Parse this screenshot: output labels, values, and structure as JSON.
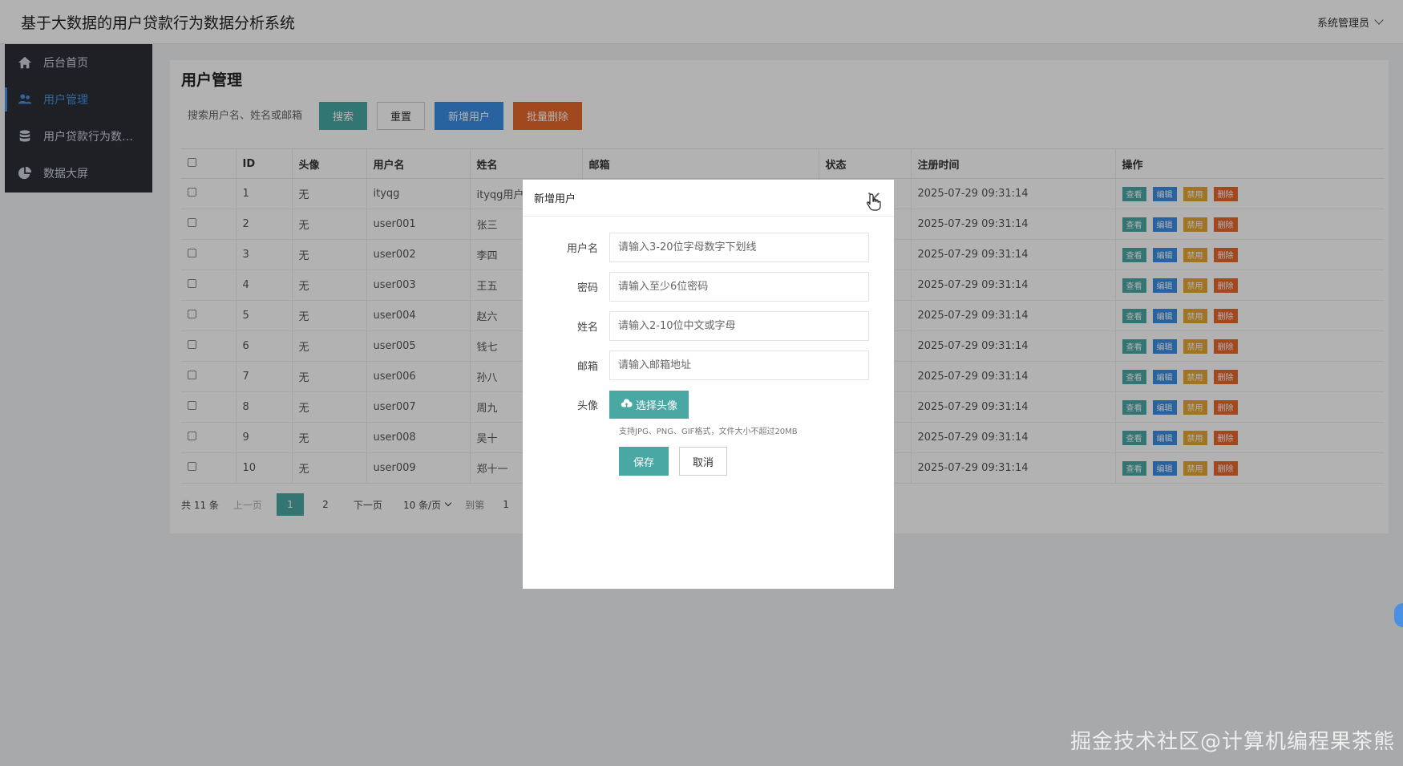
{
  "header": {
    "title": "基于大数据的用户贷款行为数据分析系统",
    "user": "系统管理员"
  },
  "sidebar": {
    "items": [
      {
        "label": "后台首页",
        "icon": "home-icon"
      },
      {
        "label": "用户管理",
        "icon": "users-icon"
      },
      {
        "label": "用户贷款行为数…",
        "icon": "database-icon"
      },
      {
        "label": "数据大屏",
        "icon": "pie-chart-icon"
      }
    ]
  },
  "main": {
    "title": "用户管理",
    "search_placeholder": "搜索用户名、姓名或邮箱",
    "buttons": {
      "search": "搜索",
      "reset": "重置",
      "add": "新增用户",
      "batch_delete": "批量删除"
    },
    "columns": [
      "ID",
      "头像",
      "用户名",
      "姓名",
      "邮箱",
      "状态",
      "注册时间",
      "操作"
    ],
    "rows": [
      {
        "id": "1",
        "avatar": "无",
        "username": "ityqg",
        "name": "ityqg用户",
        "time": "2025-07-29 09:31:14"
      },
      {
        "id": "2",
        "avatar": "无",
        "username": "user001",
        "name": "张三",
        "time": "2025-07-29 09:31:14"
      },
      {
        "id": "3",
        "avatar": "无",
        "username": "user002",
        "name": "李四",
        "time": "2025-07-29 09:31:14"
      },
      {
        "id": "4",
        "avatar": "无",
        "username": "user003",
        "name": "王五",
        "time": "2025-07-29 09:31:14"
      },
      {
        "id": "5",
        "avatar": "无",
        "username": "user004",
        "name": "赵六",
        "time": "2025-07-29 09:31:14"
      },
      {
        "id": "6",
        "avatar": "无",
        "username": "user005",
        "name": "钱七",
        "time": "2025-07-29 09:31:14"
      },
      {
        "id": "7",
        "avatar": "无",
        "username": "user006",
        "name": "孙八",
        "time": "2025-07-29 09:31:14"
      },
      {
        "id": "8",
        "avatar": "无",
        "username": "user007",
        "name": "周九",
        "time": "2025-07-29 09:31:14"
      },
      {
        "id": "9",
        "avatar": "无",
        "username": "user008",
        "name": "吴十",
        "time": "2025-07-29 09:31:14"
      },
      {
        "id": "10",
        "avatar": "无",
        "username": "user009",
        "name": "郑十一",
        "time": "2025-07-29 09:31:14"
      }
    ],
    "ops": {
      "view": "查看",
      "edit": "编辑",
      "disable": "禁用",
      "delete": "删除"
    },
    "pager": {
      "total": "共 11 条",
      "prev": "上一页",
      "pages": [
        "1",
        "2"
      ],
      "next": "下一页",
      "size": "10 条/页",
      "goto": "到第",
      "goto_value": "1"
    }
  },
  "modal": {
    "title": "新增用户",
    "fields": [
      {
        "label": "用户名",
        "placeholder": "请输入3-20位字母数字下划线"
      },
      {
        "label": "密码",
        "placeholder": "请输入至少6位密码"
      },
      {
        "label": "姓名",
        "placeholder": "请输入2-10位中文或字母"
      },
      {
        "label": "邮箱",
        "placeholder": "请输入邮箱地址"
      }
    ],
    "avatar_label": "头像",
    "upload_label": "选择头像",
    "hint": "支持JPG、PNG、GIF格式，文件大小不超过20MB",
    "save": "保存",
    "cancel": "取消"
  },
  "watermark": "掘金技术社区@计算机编程果茶熊",
  "colors": {
    "teal": "#4aa8a4",
    "blue": "#3a8ee6",
    "orange": "#e8672d",
    "yellow": "#e5a631",
    "sidebar": "#2b2f36"
  }
}
